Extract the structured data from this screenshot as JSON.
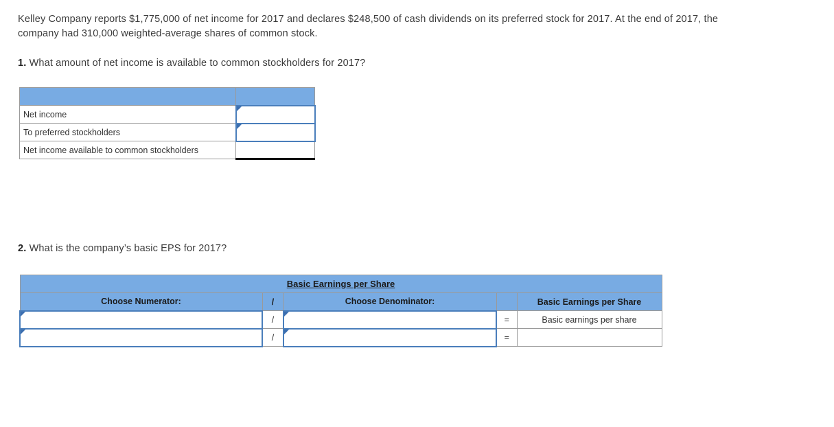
{
  "problem": {
    "statement": "Kelley Company reports $1,775,000 of net income for 2017 and declares $248,500 of cash dividends on its preferred stock for 2017. At the end of 2017, the company had 310,000 weighted-average shares of common stock."
  },
  "questions": [
    {
      "number": "1.",
      "text": "What amount of net income is available to common stockholders for 2017?"
    },
    {
      "number": "2.",
      "text": "What is the company’s basic EPS for 2017?"
    }
  ],
  "table_net_income": {
    "header": {
      "label_col": "",
      "amount_col": ""
    },
    "rows": [
      {
        "label": "Net income",
        "value": "",
        "input": true,
        "total": false
      },
      {
        "label": "To preferred stockholders",
        "value": "",
        "input": true,
        "total": false
      },
      {
        "label": "Net income available to common stockholders",
        "value": "",
        "input": false,
        "total": true
      }
    ]
  },
  "table_eps": {
    "title": "Basic Earnings per Share",
    "columns": {
      "numerator": "Choose Numerator:",
      "divider": "/",
      "denominator": "Choose Denominator:",
      "equals": "",
      "result": "Basic Earnings per Share"
    },
    "rows": [
      {
        "numerator": "",
        "divider": "/",
        "denominator": "",
        "equals": "=",
        "result": "Basic earnings per share"
      },
      {
        "numerator": "",
        "divider": "/",
        "denominator": "",
        "equals": "=",
        "result": ""
      }
    ]
  },
  "colors": {
    "header_blue": "#78ABE3",
    "input_border_blue": "#4A7EBB",
    "grid_gray": "#9a9a9a",
    "text": "#333333"
  },
  "icons": {
    "input_marker": "input-corner-arrow-icon"
  }
}
